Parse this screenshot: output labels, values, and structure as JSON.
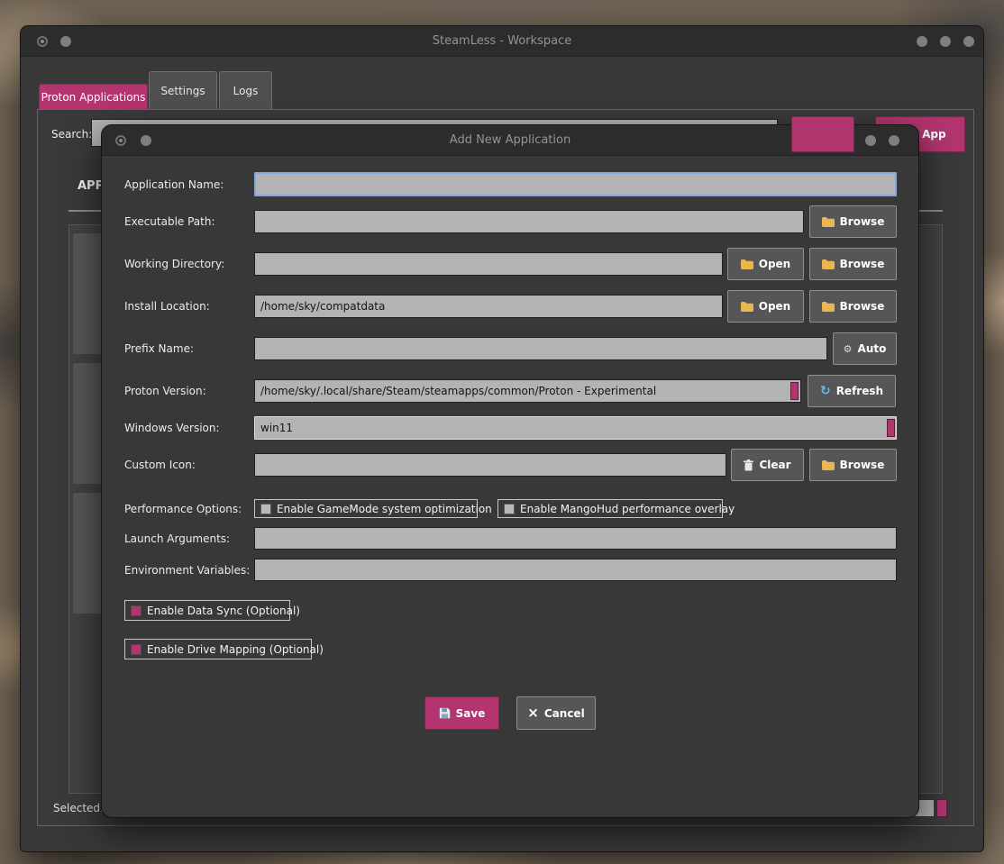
{
  "accent_color": "#b2356f",
  "main_window": {
    "title": "SteamLess - Workspace",
    "tabs": [
      {
        "label": "Proton Applications",
        "active": true
      },
      {
        "label": "Settings",
        "active": false
      },
      {
        "label": "Logs",
        "active": false
      }
    ],
    "search": {
      "label": "Search:",
      "value": ""
    },
    "add_app_button": {
      "label": "Add App"
    },
    "list": {
      "header": "APP"
    },
    "status": {
      "selected": "Selected: G"
    }
  },
  "dialog": {
    "title": "Add New Application",
    "fields": {
      "application_name": {
        "label": "Application Name:",
        "value": ""
      },
      "executable_path": {
        "label": "Executable Path:",
        "value": "",
        "browse": "Browse"
      },
      "working_directory": {
        "label": "Working Directory:",
        "value": "",
        "open": "Open",
        "browse": "Browse"
      },
      "install_location": {
        "label": "Install Location:",
        "value": "/home/sky/compatdata",
        "open": "Open",
        "browse": "Browse"
      },
      "prefix_name": {
        "label": "Prefix Name:",
        "value": "",
        "auto": "Auto"
      },
      "proton_version": {
        "label": "Proton Version:",
        "value": "/home/sky/.local/share/Steam/steamapps/common/Proton - Experimental",
        "refresh": "Refresh"
      },
      "windows_version": {
        "label": "Windows Version:",
        "value": "win11"
      },
      "custom_icon": {
        "label": "Custom Icon:",
        "value": "",
        "clear": "Clear",
        "browse": "Browse"
      },
      "performance_options": {
        "label": "Performance Options:",
        "gamemode": "Enable GameMode system optimization",
        "mangohud": "Enable MangoHud performance overlay",
        "gamemode_checked": false,
        "mangohud_checked": false
      },
      "launch_arguments": {
        "label": "Launch Arguments:",
        "value": ""
      },
      "environment_variables": {
        "label": "Environment Variables:",
        "value": ""
      }
    },
    "toggles": {
      "data_sync": {
        "label": "Enable Data Sync (Optional)",
        "checked": true
      },
      "drive_mapping": {
        "label": "Enable Drive Mapping (Optional)",
        "checked": true
      }
    },
    "actions": {
      "save": "Save",
      "cancel": "Cancel"
    }
  },
  "icons": {
    "gear_glyph": "⚙",
    "refresh_glyph": "↻",
    "close_glyph": "×"
  }
}
